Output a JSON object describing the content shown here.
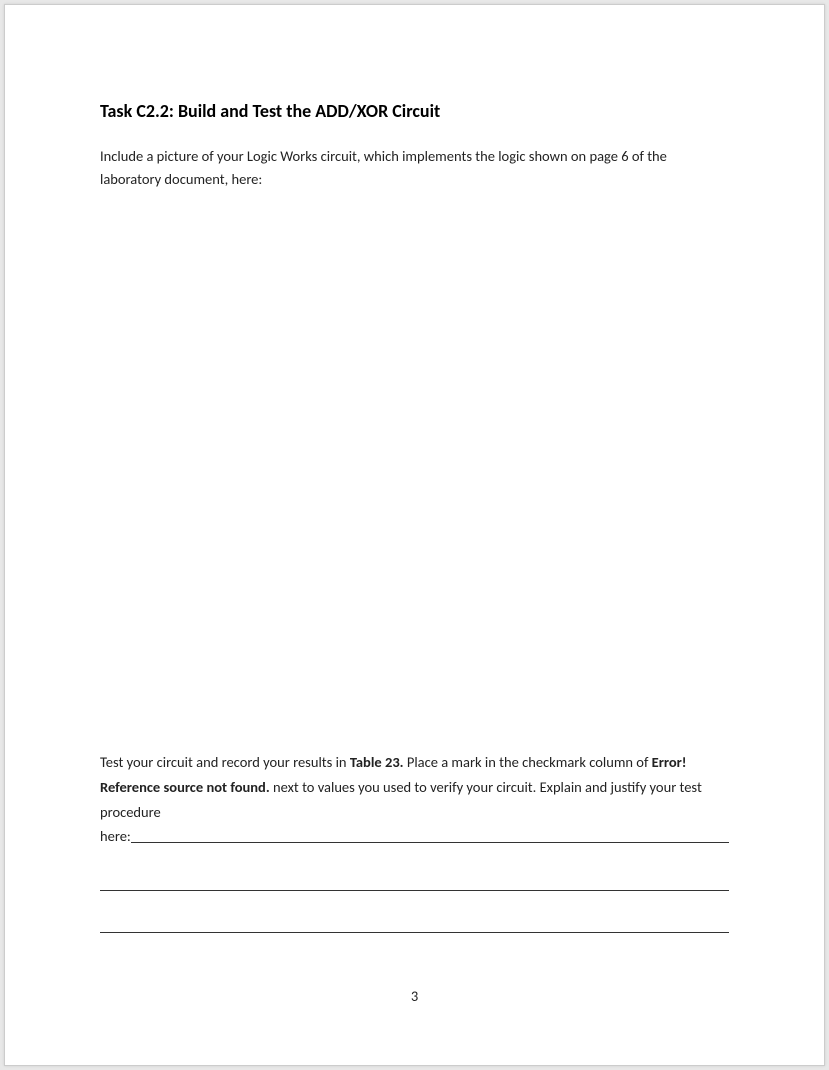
{
  "heading": "Task C2.2: Build and Test the ADD/XOR Circuit",
  "intro": "Include a picture of your Logic Works circuit, which implements the logic shown on page 6 of the laboratory document, here:",
  "instructions": {
    "part1": "Test your circuit and record your results in ",
    "bold1": "Table 23.",
    "part2": "  Place a mark in the checkmark column of ",
    "bold2": "Error! Reference source not found.",
    "part3": " next to values you used to verify your circuit. Explain and justify your test procedure",
    "here": "here:"
  },
  "page_number": "3"
}
